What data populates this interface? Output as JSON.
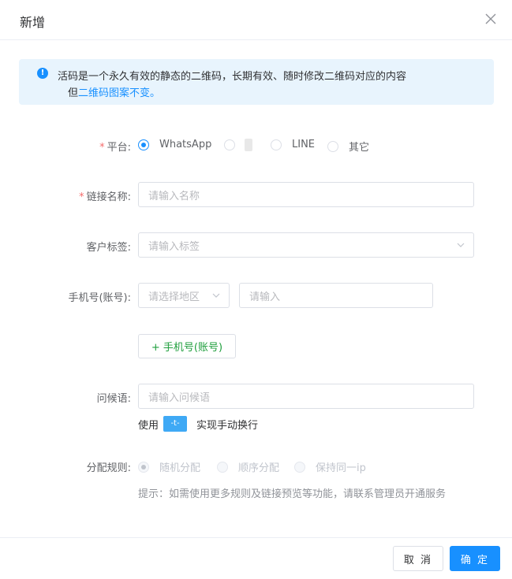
{
  "dialog": {
    "title": "新增",
    "close_icon": "close-icon"
  },
  "alert": {
    "icon": "info-icon",
    "line1": "活码是一个永久有效的静态的二维码，长期有效、随时修改二维码对应的内容",
    "line2_prefix": "但",
    "line2_highlight": "二维码图案不变。"
  },
  "form": {
    "platform": {
      "required_mark": "*",
      "label": "平台:",
      "options": [
        {
          "label": "WhatsApp",
          "selected": true
        },
        {
          "label": "",
          "selected": false,
          "icon": "platform-logo-icon"
        },
        {
          "label": "LINE",
          "selected": false
        },
        {
          "label": "其它",
          "selected": false
        }
      ]
    },
    "link_name": {
      "required_mark": "*",
      "label": "链接名称:",
      "placeholder": "请输入名称",
      "value": ""
    },
    "customer_tag": {
      "label": "客户标签:",
      "placeholder": "请输入标签",
      "value": ""
    },
    "phone": {
      "label": "手机号(账号):",
      "region_placeholder": "请选择地区",
      "number_placeholder": "请输入",
      "add_button": "+ 手机号(账号)"
    },
    "greeting": {
      "label": "问候语:",
      "placeholder": "请输入问候语",
      "value": "",
      "hint_prefix": "使用",
      "hint_key": "-t-",
      "hint_suffix": "实现手动换行"
    },
    "distribution": {
      "label": "分配规则:",
      "options": [
        {
          "label": "随机分配",
          "selected": true
        },
        {
          "label": "顺序分配",
          "selected": false
        },
        {
          "label": "保持同一ip",
          "selected": false
        }
      ],
      "tip": "提示：如需使用更多规则及链接预览等功能，请联系管理员开通服务"
    }
  },
  "footer": {
    "cancel": "取 消",
    "confirm": "确 定"
  },
  "colors": {
    "primary": "#1890ff",
    "required": "#f56c6c",
    "add_button_text": "#1e9e3c",
    "alert_bg": "#e8f4fd"
  }
}
